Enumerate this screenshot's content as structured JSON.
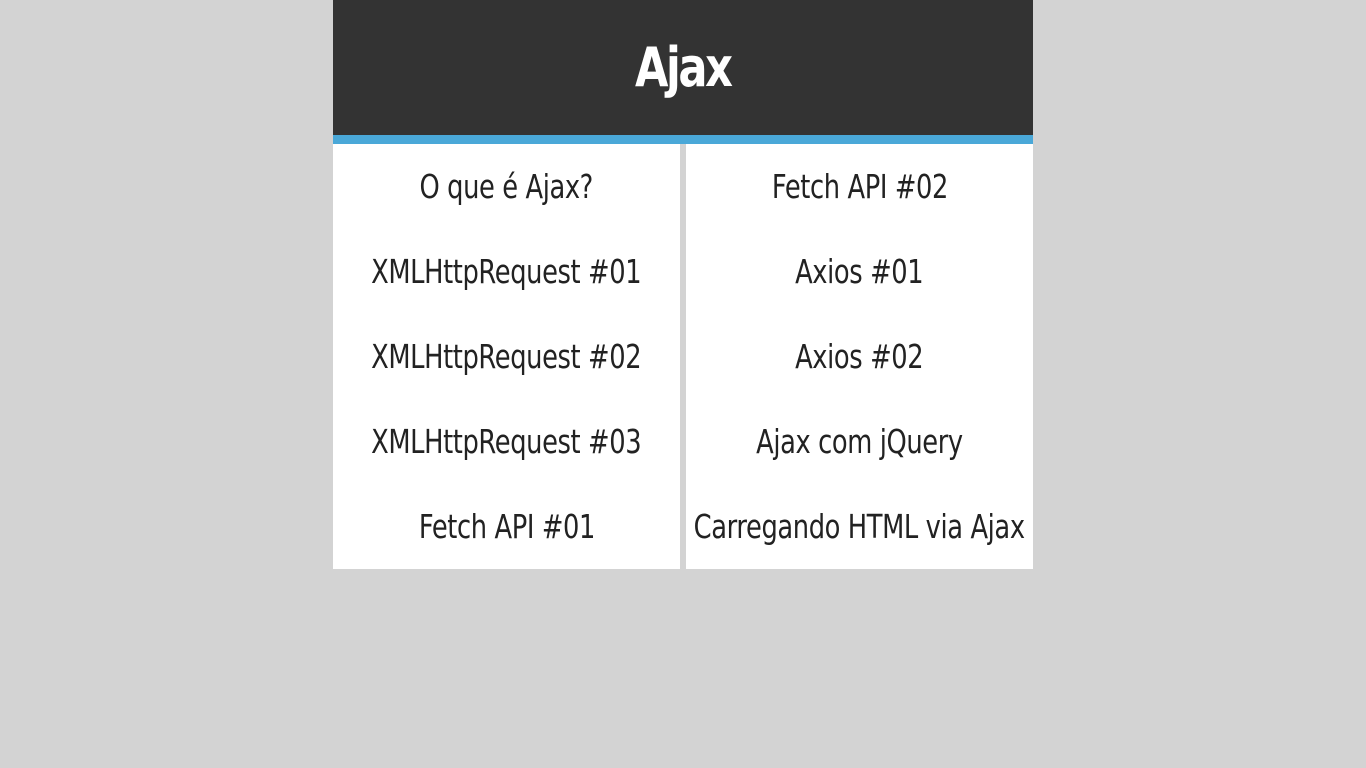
{
  "header": {
    "title": "Ajax"
  },
  "menu": {
    "left": [
      "O que é Ajax?",
      "XMLHttpRequest #01",
      "XMLHttpRequest #02",
      "XMLHttpRequest #03",
      "Fetch API #01"
    ],
    "right": [
      "Fetch API #02",
      "Axios #01",
      "Axios #02",
      "Ajax com jQuery",
      "Carregando HTML via Ajax"
    ]
  },
  "colors": {
    "page_bg": "#d3d3d3",
    "header_bg": "#333333",
    "accent": "#4aa8d8",
    "panel_bg": "#ffffff",
    "text": "#222222"
  }
}
